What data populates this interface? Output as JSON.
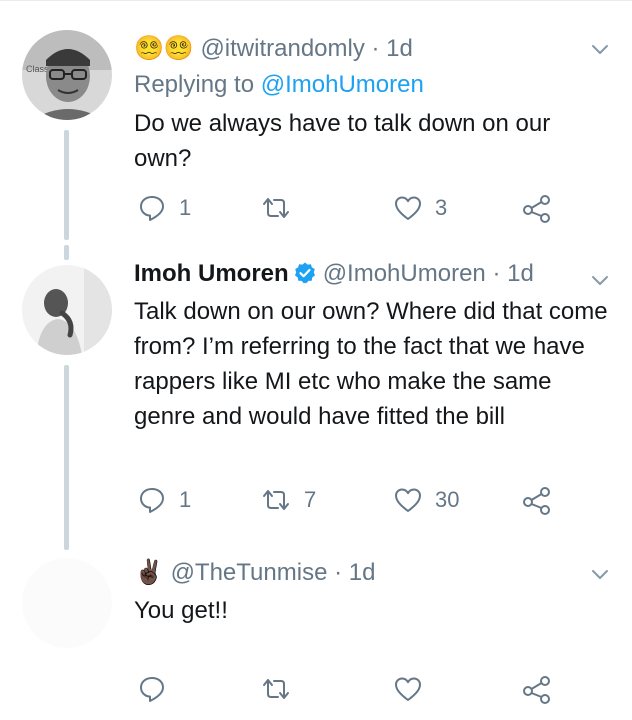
{
  "tweets": [
    {
      "handle_prefix_emoji": "😵‍💫😵‍💫",
      "handle": "@itwitrandomly",
      "time": "· 1d",
      "replying_label": "Replying to",
      "replying_handle": "@ImohUmoren",
      "text": "Do we always have to talk down on our own?",
      "reply_count": "1",
      "retweet_count": "",
      "like_count": "3",
      "avatar_icon": "avatar-person-glasses"
    },
    {
      "name": "Imoh Umoren",
      "verified": true,
      "handle": "@ImohUmoren",
      "time": "· 1d",
      "text": "Talk down on our own? Where did that come from? I’m referring to the fact that we have rappers like MI etc who make the same genre and would have fitted the bill",
      "reply_count": "1",
      "retweet_count": "7",
      "like_count": "30",
      "avatar_icon": "avatar-person-bw"
    },
    {
      "handle_prefix_emoji": "✌🏿",
      "handle": "@TheTunmise",
      "time": "· 1d",
      "text": "You get!!",
      "reply_count": "",
      "retweet_count": "",
      "like_count": "",
      "avatar_icon": "avatar-blank"
    }
  ],
  "colors": {
    "text": "#14171a",
    "secondary": "#657786",
    "link": "#1da1f2",
    "thread_line": "#ccd6dd",
    "verified": "#1da1f2"
  }
}
